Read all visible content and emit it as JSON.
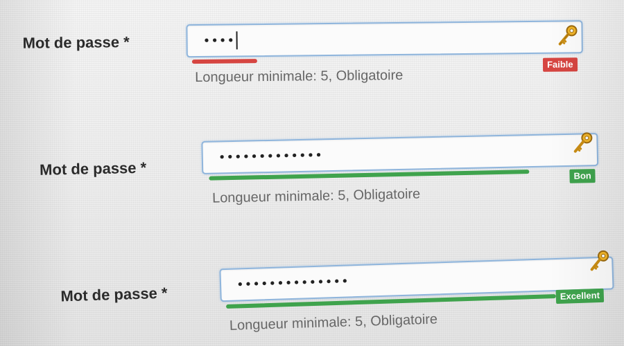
{
  "fields": [
    {
      "label": "Mot de passe *",
      "value": "••••",
      "strength_label": "Faible",
      "strength_fraction": 0.17,
      "strength_color": "#d64541",
      "hint": "Longueur minimale: 5, Obligatoire",
      "has_caret": true,
      "icon": "key-icon"
    },
    {
      "label": "Mot de passe *",
      "value": "•••••••••••••",
      "strength_label": "Bon",
      "strength_fraction": 0.85,
      "strength_color": "#3fa34d",
      "hint": "Longueur minimale: 5, Obligatoire",
      "has_caret": false,
      "icon": "key-icon"
    },
    {
      "label": "Mot de passe *",
      "value": "••••••••••••••",
      "strength_label": "Excellent",
      "strength_fraction": 1.0,
      "strength_color": "#3fa34d",
      "hint": "Longueur minimale: 5, Obligatoire",
      "has_caret": false,
      "icon": "key-icon"
    }
  ],
  "colors": {
    "input_border": "#8fb5dc",
    "label_text": "#2b2b2b",
    "hint_text": "#666666",
    "weak": "#d64541",
    "good": "#3fa34d"
  }
}
